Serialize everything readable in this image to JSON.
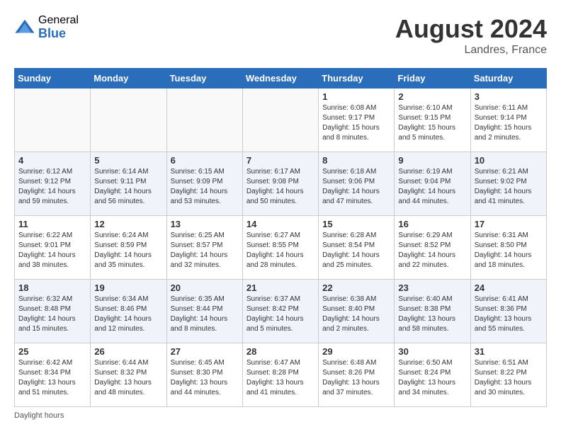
{
  "header": {
    "logo_general": "General",
    "logo_blue": "Blue",
    "month_year": "August 2024",
    "location": "Landres, France"
  },
  "weekdays": [
    "Sunday",
    "Monday",
    "Tuesday",
    "Wednesday",
    "Thursday",
    "Friday",
    "Saturday"
  ],
  "weeks": [
    [
      {
        "day": "",
        "info": ""
      },
      {
        "day": "",
        "info": ""
      },
      {
        "day": "",
        "info": ""
      },
      {
        "day": "",
        "info": ""
      },
      {
        "day": "1",
        "info": "Sunrise: 6:08 AM\nSunset: 9:17 PM\nDaylight: 15 hours\nand 8 minutes."
      },
      {
        "day": "2",
        "info": "Sunrise: 6:10 AM\nSunset: 9:15 PM\nDaylight: 15 hours\nand 5 minutes."
      },
      {
        "day": "3",
        "info": "Sunrise: 6:11 AM\nSunset: 9:14 PM\nDaylight: 15 hours\nand 2 minutes."
      }
    ],
    [
      {
        "day": "4",
        "info": "Sunrise: 6:12 AM\nSunset: 9:12 PM\nDaylight: 14 hours\nand 59 minutes."
      },
      {
        "day": "5",
        "info": "Sunrise: 6:14 AM\nSunset: 9:11 PM\nDaylight: 14 hours\nand 56 minutes."
      },
      {
        "day": "6",
        "info": "Sunrise: 6:15 AM\nSunset: 9:09 PM\nDaylight: 14 hours\nand 53 minutes."
      },
      {
        "day": "7",
        "info": "Sunrise: 6:17 AM\nSunset: 9:08 PM\nDaylight: 14 hours\nand 50 minutes."
      },
      {
        "day": "8",
        "info": "Sunrise: 6:18 AM\nSunset: 9:06 PM\nDaylight: 14 hours\nand 47 minutes."
      },
      {
        "day": "9",
        "info": "Sunrise: 6:19 AM\nSunset: 9:04 PM\nDaylight: 14 hours\nand 44 minutes."
      },
      {
        "day": "10",
        "info": "Sunrise: 6:21 AM\nSunset: 9:02 PM\nDaylight: 14 hours\nand 41 minutes."
      }
    ],
    [
      {
        "day": "11",
        "info": "Sunrise: 6:22 AM\nSunset: 9:01 PM\nDaylight: 14 hours\nand 38 minutes."
      },
      {
        "day": "12",
        "info": "Sunrise: 6:24 AM\nSunset: 8:59 PM\nDaylight: 14 hours\nand 35 minutes."
      },
      {
        "day": "13",
        "info": "Sunrise: 6:25 AM\nSunset: 8:57 PM\nDaylight: 14 hours\nand 32 minutes."
      },
      {
        "day": "14",
        "info": "Sunrise: 6:27 AM\nSunset: 8:55 PM\nDaylight: 14 hours\nand 28 minutes."
      },
      {
        "day": "15",
        "info": "Sunrise: 6:28 AM\nSunset: 8:54 PM\nDaylight: 14 hours\nand 25 minutes."
      },
      {
        "day": "16",
        "info": "Sunrise: 6:29 AM\nSunset: 8:52 PM\nDaylight: 14 hours\nand 22 minutes."
      },
      {
        "day": "17",
        "info": "Sunrise: 6:31 AM\nSunset: 8:50 PM\nDaylight: 14 hours\nand 18 minutes."
      }
    ],
    [
      {
        "day": "18",
        "info": "Sunrise: 6:32 AM\nSunset: 8:48 PM\nDaylight: 14 hours\nand 15 minutes."
      },
      {
        "day": "19",
        "info": "Sunrise: 6:34 AM\nSunset: 8:46 PM\nDaylight: 14 hours\nand 12 minutes."
      },
      {
        "day": "20",
        "info": "Sunrise: 6:35 AM\nSunset: 8:44 PM\nDaylight: 14 hours\nand 8 minutes."
      },
      {
        "day": "21",
        "info": "Sunrise: 6:37 AM\nSunset: 8:42 PM\nDaylight: 14 hours\nand 5 minutes."
      },
      {
        "day": "22",
        "info": "Sunrise: 6:38 AM\nSunset: 8:40 PM\nDaylight: 14 hours\nand 2 minutes."
      },
      {
        "day": "23",
        "info": "Sunrise: 6:40 AM\nSunset: 8:38 PM\nDaylight: 13 hours\nand 58 minutes."
      },
      {
        "day": "24",
        "info": "Sunrise: 6:41 AM\nSunset: 8:36 PM\nDaylight: 13 hours\nand 55 minutes."
      }
    ],
    [
      {
        "day": "25",
        "info": "Sunrise: 6:42 AM\nSunset: 8:34 PM\nDaylight: 13 hours\nand 51 minutes."
      },
      {
        "day": "26",
        "info": "Sunrise: 6:44 AM\nSunset: 8:32 PM\nDaylight: 13 hours\nand 48 minutes."
      },
      {
        "day": "27",
        "info": "Sunrise: 6:45 AM\nSunset: 8:30 PM\nDaylight: 13 hours\nand 44 minutes."
      },
      {
        "day": "28",
        "info": "Sunrise: 6:47 AM\nSunset: 8:28 PM\nDaylight: 13 hours\nand 41 minutes."
      },
      {
        "day": "29",
        "info": "Sunrise: 6:48 AM\nSunset: 8:26 PM\nDaylight: 13 hours\nand 37 minutes."
      },
      {
        "day": "30",
        "info": "Sunrise: 6:50 AM\nSunset: 8:24 PM\nDaylight: 13 hours\nand 34 minutes."
      },
      {
        "day": "31",
        "info": "Sunrise: 6:51 AM\nSunset: 8:22 PM\nDaylight: 13 hours\nand 30 minutes."
      }
    ]
  ],
  "footer": {
    "daylight_label": "Daylight hours"
  }
}
